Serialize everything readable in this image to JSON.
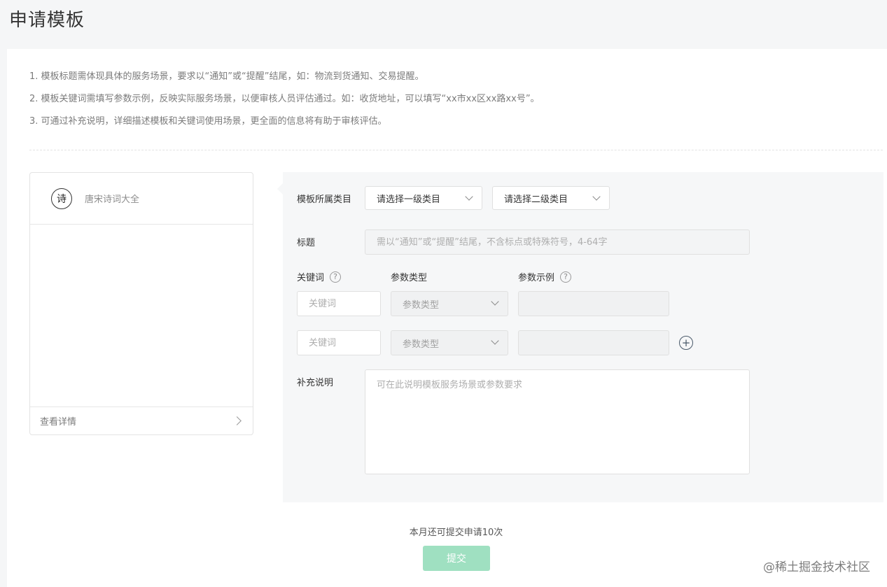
{
  "page": {
    "title": "申请模板"
  },
  "tips": [
    "1. 模板标题需体现具体的服务场景，要求以“通知”或“提醒”结尾，如：物流到货通知、交易提醒。",
    "2. 模板关键词需填写参数示例，反映实际服务场景，以便审核人员评估通过。如：收货地址，可以填写“xx市xx区xx路xx号”。",
    "3. 可通过补充说明，详细描述模板和关键词使用场景，更全面的信息将有助于审核评估。"
  ],
  "preview": {
    "logo_text": "诗",
    "app_name": "唐宋诗词大全",
    "details_link": "查看详情"
  },
  "form": {
    "category_label": "模板所属类目",
    "category_level1": "请选择一级类目",
    "category_level2": "请选择二级类目",
    "title_label": "标题",
    "title_placeholder": "需以“通知”或“提醒”结尾，不含标点或特殊符号，4-64字",
    "keyword_header": "关键词",
    "param_type_header": "参数类型",
    "param_example_header": "参数示例",
    "help_icon": "?",
    "keyword_rows": [
      {
        "keyword_placeholder": "关键词",
        "param_type": "参数类型",
        "example": ""
      },
      {
        "keyword_placeholder": "关键词",
        "param_type": "参数类型",
        "example": ""
      }
    ],
    "add_symbol": "+",
    "remark_label": "补充说明",
    "remark_placeholder": "可在此说明模板服务场景或参数要求"
  },
  "footer": {
    "quota_text": "本月还可提交申请10次",
    "submit_label": "提交",
    "submit_color": "#9fe0c1"
  },
  "watermark": "@稀土掘金技术社区"
}
